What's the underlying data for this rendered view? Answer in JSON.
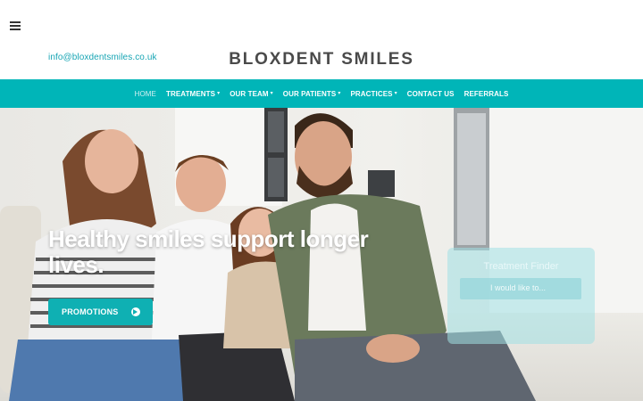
{
  "header": {
    "email": "info@bloxdentsmiles.co.uk",
    "logo": "BLOXDENT SMILES",
    "menu_icon": "hamburger-menu-icon"
  },
  "nav": {
    "items": [
      {
        "label": "HOME",
        "has_dropdown": false,
        "active": true
      },
      {
        "label": "TREATMENTS",
        "has_dropdown": true
      },
      {
        "label": "OUR TEAM",
        "has_dropdown": true
      },
      {
        "label": "OUR PATIENTS",
        "has_dropdown": true
      },
      {
        "label": "PRACTICES",
        "has_dropdown": true
      },
      {
        "label": "CONTACT US",
        "has_dropdown": false
      },
      {
        "label": "REFERRALS",
        "has_dropdown": false
      }
    ],
    "dropdown_glyph": "▾"
  },
  "hero": {
    "title": "Healthy smiles support longer lives.",
    "promo_button": "PROMOTIONS",
    "promo_icon": "arrow-right-circle-icon"
  },
  "treatment_finder": {
    "title": "Treatment Finder",
    "select_placeholder": "I would like to..."
  },
  "colors": {
    "brand_teal": "#00b5b8",
    "email_link": "#17a5b4",
    "logo_text": "#4a4a4a"
  }
}
